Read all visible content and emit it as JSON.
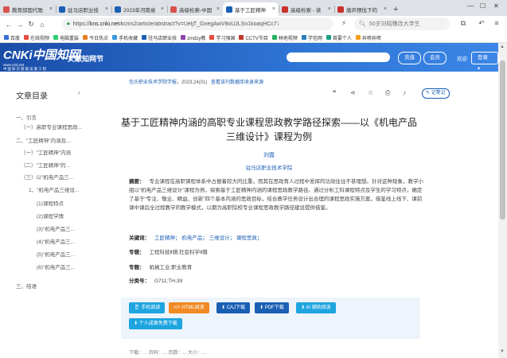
{
  "browser": {
    "tabs": [
      {
        "label": "教育部国代歌",
        "color": "#d9534f",
        "active": false
      },
      {
        "label": "驻马店职业技",
        "color": "#1a5fb4",
        "active": false
      },
      {
        "label": "2023年河南省",
        "color": "#1a5fb4",
        "active": false
      },
      {
        "label": "高级检索-中国",
        "color": "#d9534f",
        "active": false
      },
      {
        "label": "基于工匠精神",
        "color": "#1a5fb4",
        "active": true
      },
      {
        "label": "高级检索 - 读",
        "color": "#c9302c",
        "active": false
      },
      {
        "label": "唐声预估下的",
        "color": "#c9302c",
        "active": false
      }
    ],
    "url_prefix": "https://",
    "url_host": "kns.cnki.net",
    "url_path": "/kcms2/article/abstract?v=UeljT_GnegAwV8oUJLSn1koaqHCc77Kb14l",
    "search_placeholder": "50岁刘昭曝改大学生",
    "bookmarks": [
      {
        "label": "百度",
        "color": "#3b6fd8"
      },
      {
        "label": "在线视频",
        "color": "#e74c3c"
      },
      {
        "label": "电脑重装",
        "color": "#2ecc71"
      },
      {
        "label": "今日热点",
        "color": "#e67e22"
      },
      {
        "label": "手机收藏",
        "color": "#3498db"
      },
      {
        "label": "驻马店职业技",
        "color": "#1a5fb4"
      },
      {
        "label": "zmdzy教",
        "color": "#8e44ad"
      },
      {
        "label": "学习强国",
        "color": "#e74c3c"
      },
      {
        "label": "CCTV节目",
        "color": "#c0392b"
      },
      {
        "label": "林地视频",
        "color": "#27ae60"
      },
      {
        "label": "学信网",
        "color": "#2980b9"
      },
      {
        "label": "首要个人",
        "color": "#16a085"
      },
      {
        "label": "井喷井喷",
        "color": "#f39c12"
      }
    ]
  },
  "cnki": {
    "logo_text": "CNKi中国知网",
    "logo_url": "www.cnki.net",
    "logo_sub": "中国知识基础设施工程",
    "site_name": "文献知网节",
    "btn_first": "充值",
    "btn_member": "会员",
    "welcome": "欢迎",
    "login": "登录"
  },
  "toc": {
    "title": "文章目录",
    "items": [
      {
        "text": "一、引言"
      },
      {
        "text": "（一）高职专业课程思政..."
      },
      {
        "text": "二、\"工匠精神\"内涵及..."
      },
      {
        "text": "（一）\"工匠精神\"内涵"
      },
      {
        "text": "（二）\"工匠精神\"的..."
      },
      {
        "text": "（三）以\"机电产品三..."
      },
      {
        "text": "1、\"机电产品三维设..."
      },
      {
        "text": "(1)课程特点"
      },
      {
        "text": "(2)课程学情"
      },
      {
        "text": "(3)\"机电产品三..."
      },
      {
        "text": "(4)\"机电产品三..."
      },
      {
        "text": "(5)\"机电产品三..."
      },
      {
        "text": "(6)\"机电产品三..."
      },
      {
        "text": "三、结语"
      }
    ]
  },
  "article": {
    "journal": "包头职业技术学院学报",
    "issue": "，2023,24(01)",
    "journal_link": "查看该刊数据库收录来源",
    "note_btn": "记笔记",
    "title_line1": "基于工匠精神内涵的高职专业课程思政教学路径探索——以《机电产品",
    "title_line2": "三维设计》课程为例",
    "author": "刘霞",
    "institution": "驻马店职业技术学院",
    "abstract_label": "摘要：",
    "abstract": "专业课程在高职课程体系中占据着较大的比重，而其在思政育人过程中发挥的功效往往不甚理想。针对这种现象，教学小组以“机电产品三维设计”课程为例，探索基于工匠精神内涵的课程思政教学路径。通过分析工科课程特点及学生的学习特点，确定了基于“专注、敬业、精益、创新”四个基本内涵的思政目标，结合教学任务设计出合理的课程思政实施方案，借鉴线上线下、课前课中课后全过程教学的教学模式，以期为高职院校专业课程思政教学路径建设提供借鉴。",
    "keywords_label": "关键词：",
    "keywords": "工匠精神；  机电产品；  三维设计；  课程思政；",
    "collection_label": "专辑：",
    "collection": "工程科技Ⅱ辑;社会科学Ⅱ辑",
    "special_label": "专题：",
    "special": "机械工业;职业教育",
    "class_label": "分类号：",
    "class": "G711;TH-39",
    "downloads": [
      {
        "label": "手机阅读",
        "color": "#1ea5e0"
      },
      {
        "label": "HTML阅读",
        "color": "#f08a24"
      },
      {
        "label": "CAJ下载",
        "color": "#1a5fb4"
      },
      {
        "label": "PDF下载",
        "color": "#1a5fb4"
      },
      {
        "label": "AI 辅助阅读",
        "color": "#1ea5e0"
      }
    ],
    "personal_download": "个人成果免费下载",
    "bottom_text": "下载：...  页码：...  页数：...  大小：..."
  }
}
